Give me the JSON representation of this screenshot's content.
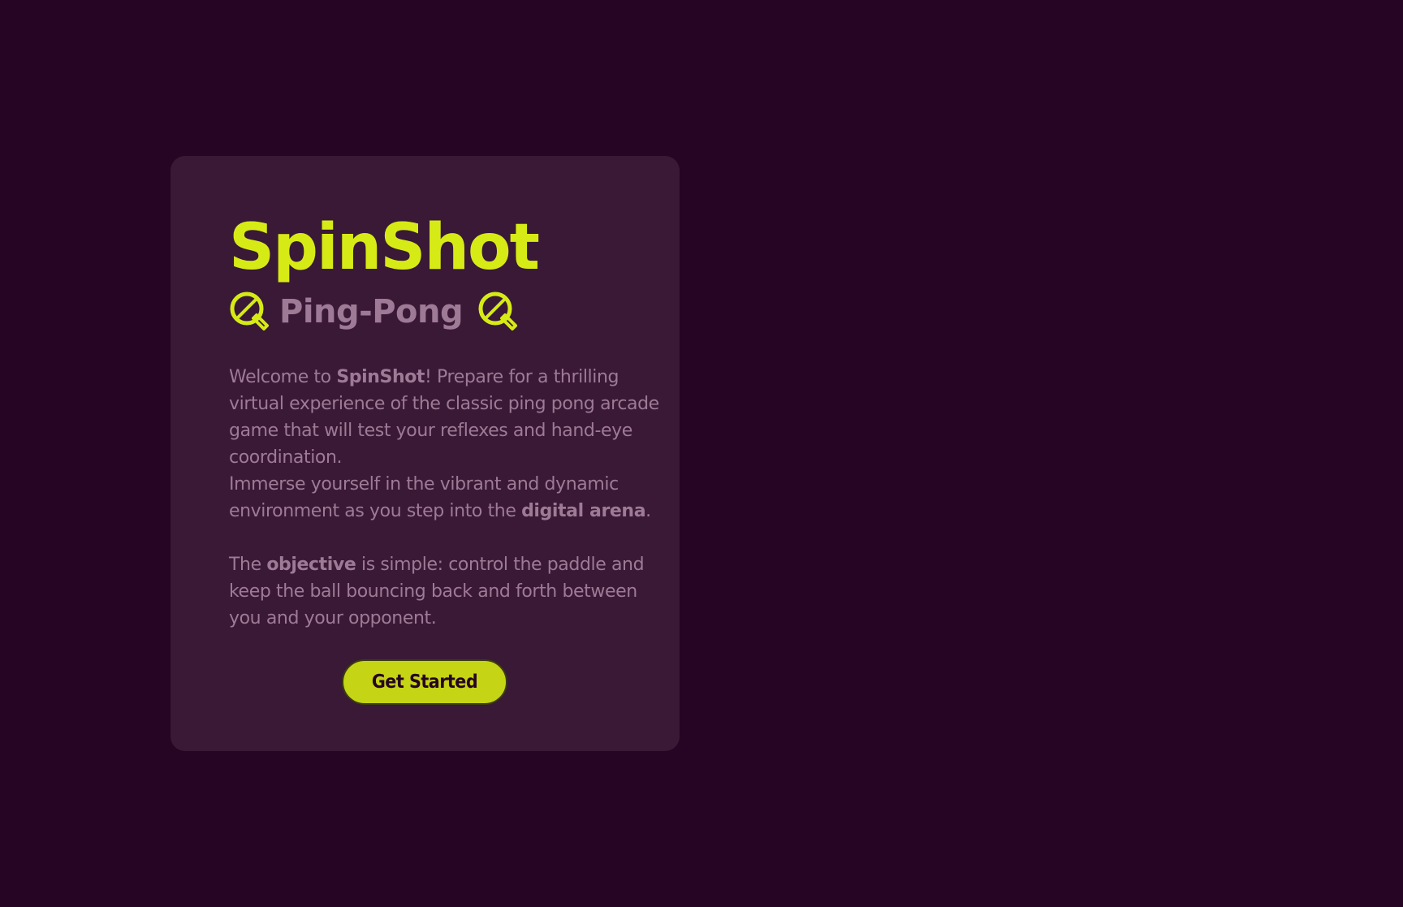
{
  "card": {
    "title": "SpinShot",
    "subtitle": "Ping-Pong",
    "icons": [
      "ping-pong-paddle-icon",
      "ping-pong-paddle-icon"
    ],
    "paragraph1": {
      "t1": "Welcome to ",
      "b1": "SpinShot",
      "t2": "! Prepare for a thrilling virtual experience of the classic ping pong arcade game that will test your reflexes and hand-eye coordination."
    },
    "paragraph2": {
      "t1": "Immerse yourself in the vibrant and dynamic environment as you step into the ",
      "b1": "digital arena",
      "t2": "."
    },
    "paragraph3": {
      "t1": "The ",
      "b1": "objective",
      "t2": " is simple: control the paddle and keep the ball bouncing back and forth between you and your opponent."
    },
    "button_label": "Get Started"
  },
  "colors": {
    "background": "#260423",
    "card": "#391936",
    "accent": "#d6eb16",
    "muted_text": "#9e7a96",
    "button": "#c5d414"
  }
}
